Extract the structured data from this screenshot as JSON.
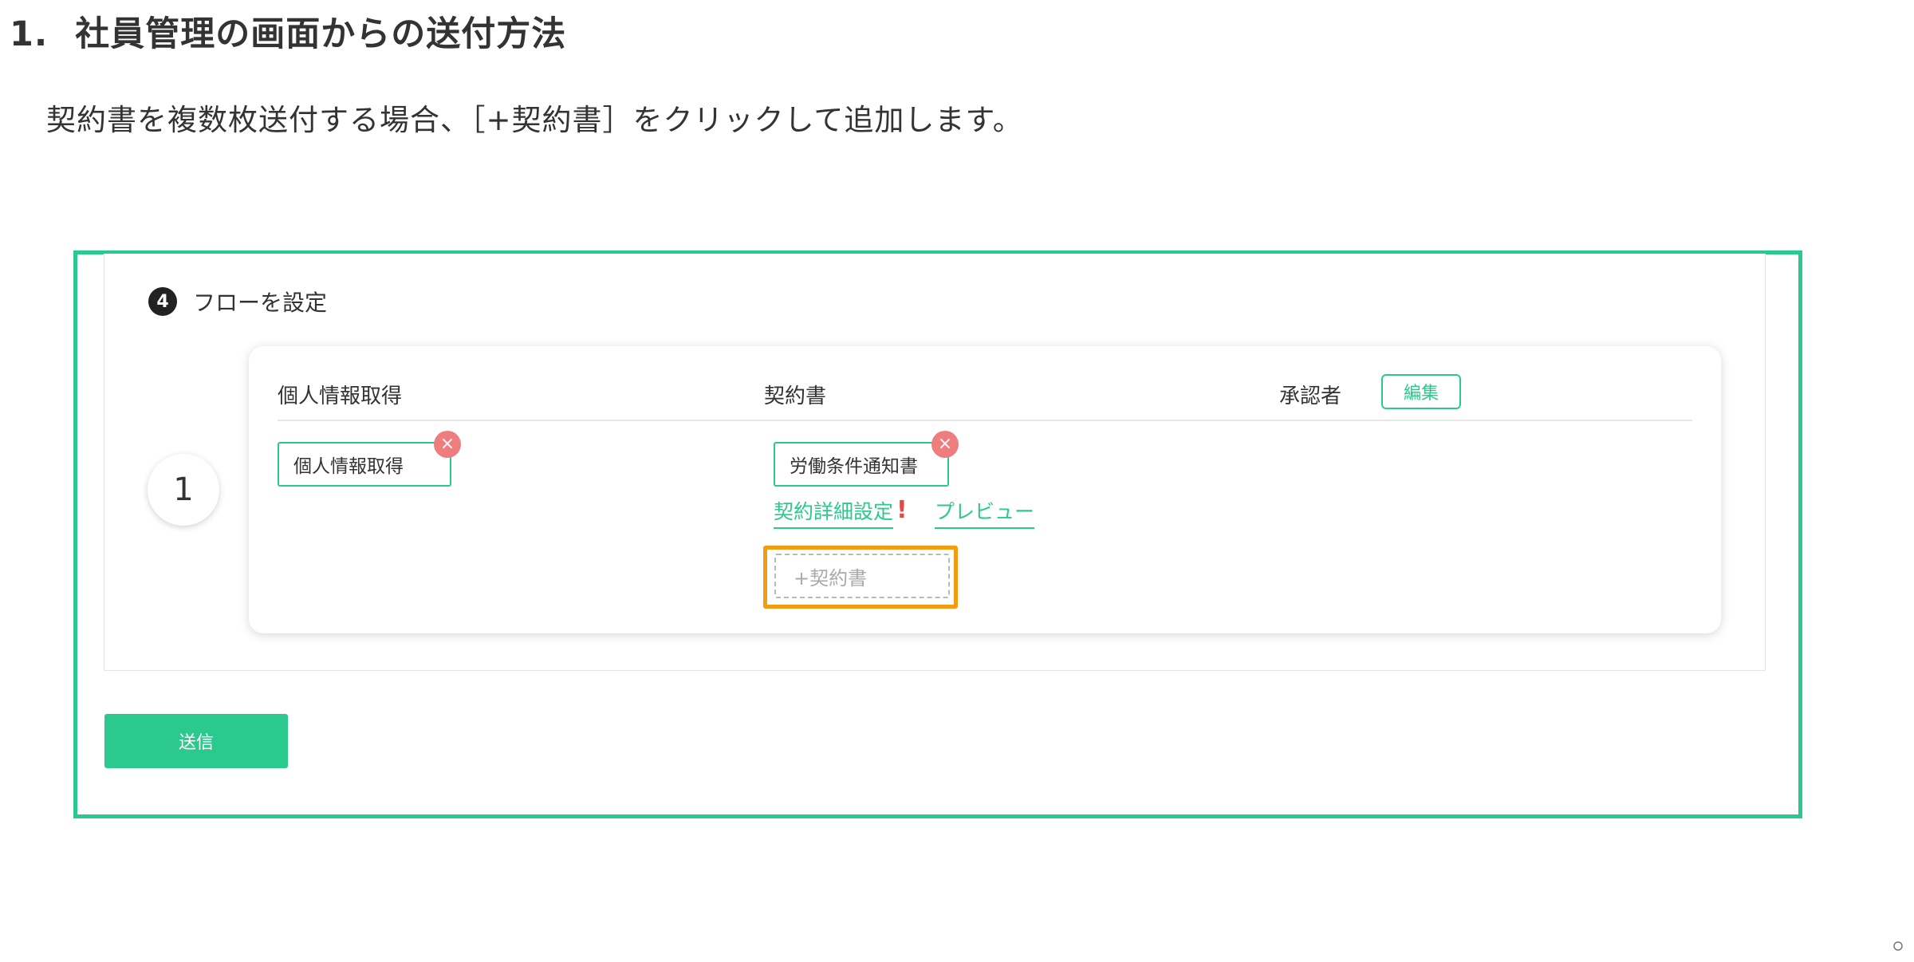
{
  "heading": {
    "number": "1.",
    "title": "社員管理の画面からの送付方法"
  },
  "intro": "契約書を複数枚送付する場合、［+契約書］をクリックして追加します。",
  "flow": {
    "step_number": "4",
    "step_label": "フローを設定",
    "order": "1",
    "columns": {
      "personal_info": "個人情報取得",
      "contract": "契約書",
      "approver": "承認者"
    },
    "edit_label": "編集",
    "personal_info_chip": "個人情報取得",
    "contract_chip": "労働条件通知書",
    "remove_symbol": "×",
    "detail_link": "契約詳細設定",
    "warning_symbol": "!",
    "preview_link": "プレビュー",
    "add_contract_label": "+契約書"
  },
  "send_label": "送信",
  "corner_icon": "circle-icon",
  "colors": {
    "accent": "#2cc98f",
    "highlight": "#f39c12",
    "remove": "#f07d7d",
    "warning": "#e24a4a"
  }
}
